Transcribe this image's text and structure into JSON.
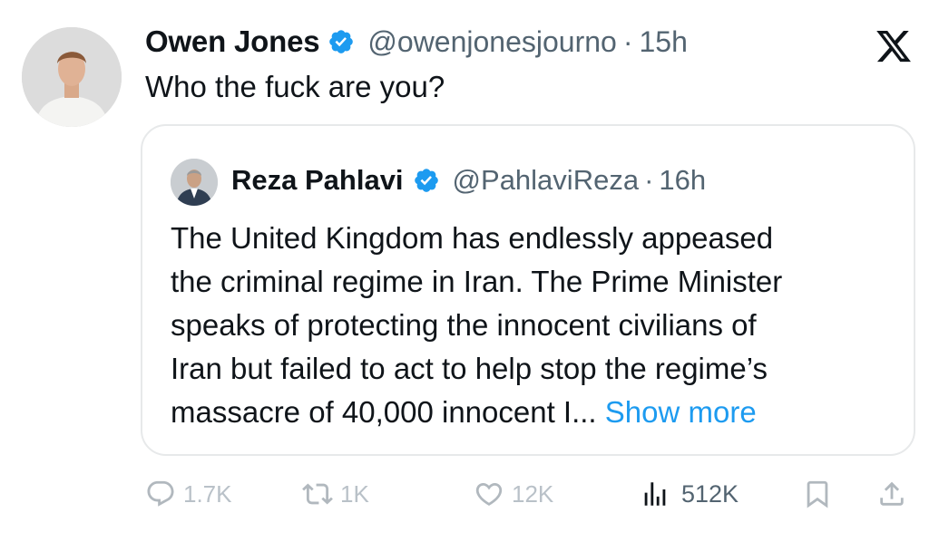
{
  "tweet": {
    "author_name": "Owen Jones",
    "handle": "@owenjonesjourno",
    "separator": "·",
    "time": "15h",
    "text": "Who the fuck are you?"
  },
  "quoted_tweet": {
    "author_name": "Reza Pahlavi",
    "handle": "@PahlaviReza",
    "separator": "·",
    "time": "16h",
    "lines": [
      "The United Kingdom has endlessly appeased",
      "the criminal regime in Iran. The Prime Minister",
      "speaks of protecting the innocent civilians of",
      "Iran but failed to act to help stop the regime’s",
      "massacre of 40,000 innocent I..."
    ],
    "show_more": "Show more"
  },
  "actions": {
    "replies": "1.7K",
    "reposts": "1K",
    "likes": "12K",
    "views": "512K"
  },
  "icons": [
    "x-logo-icon",
    "verified-badge-icon",
    "reply-icon",
    "repost-icon",
    "like-icon",
    "views-icon",
    "bookmark-icon",
    "share-icon"
  ],
  "colors": {
    "verified": "#1d9bf0",
    "link": "#1d9bf0",
    "secondary_text": "#536471"
  }
}
